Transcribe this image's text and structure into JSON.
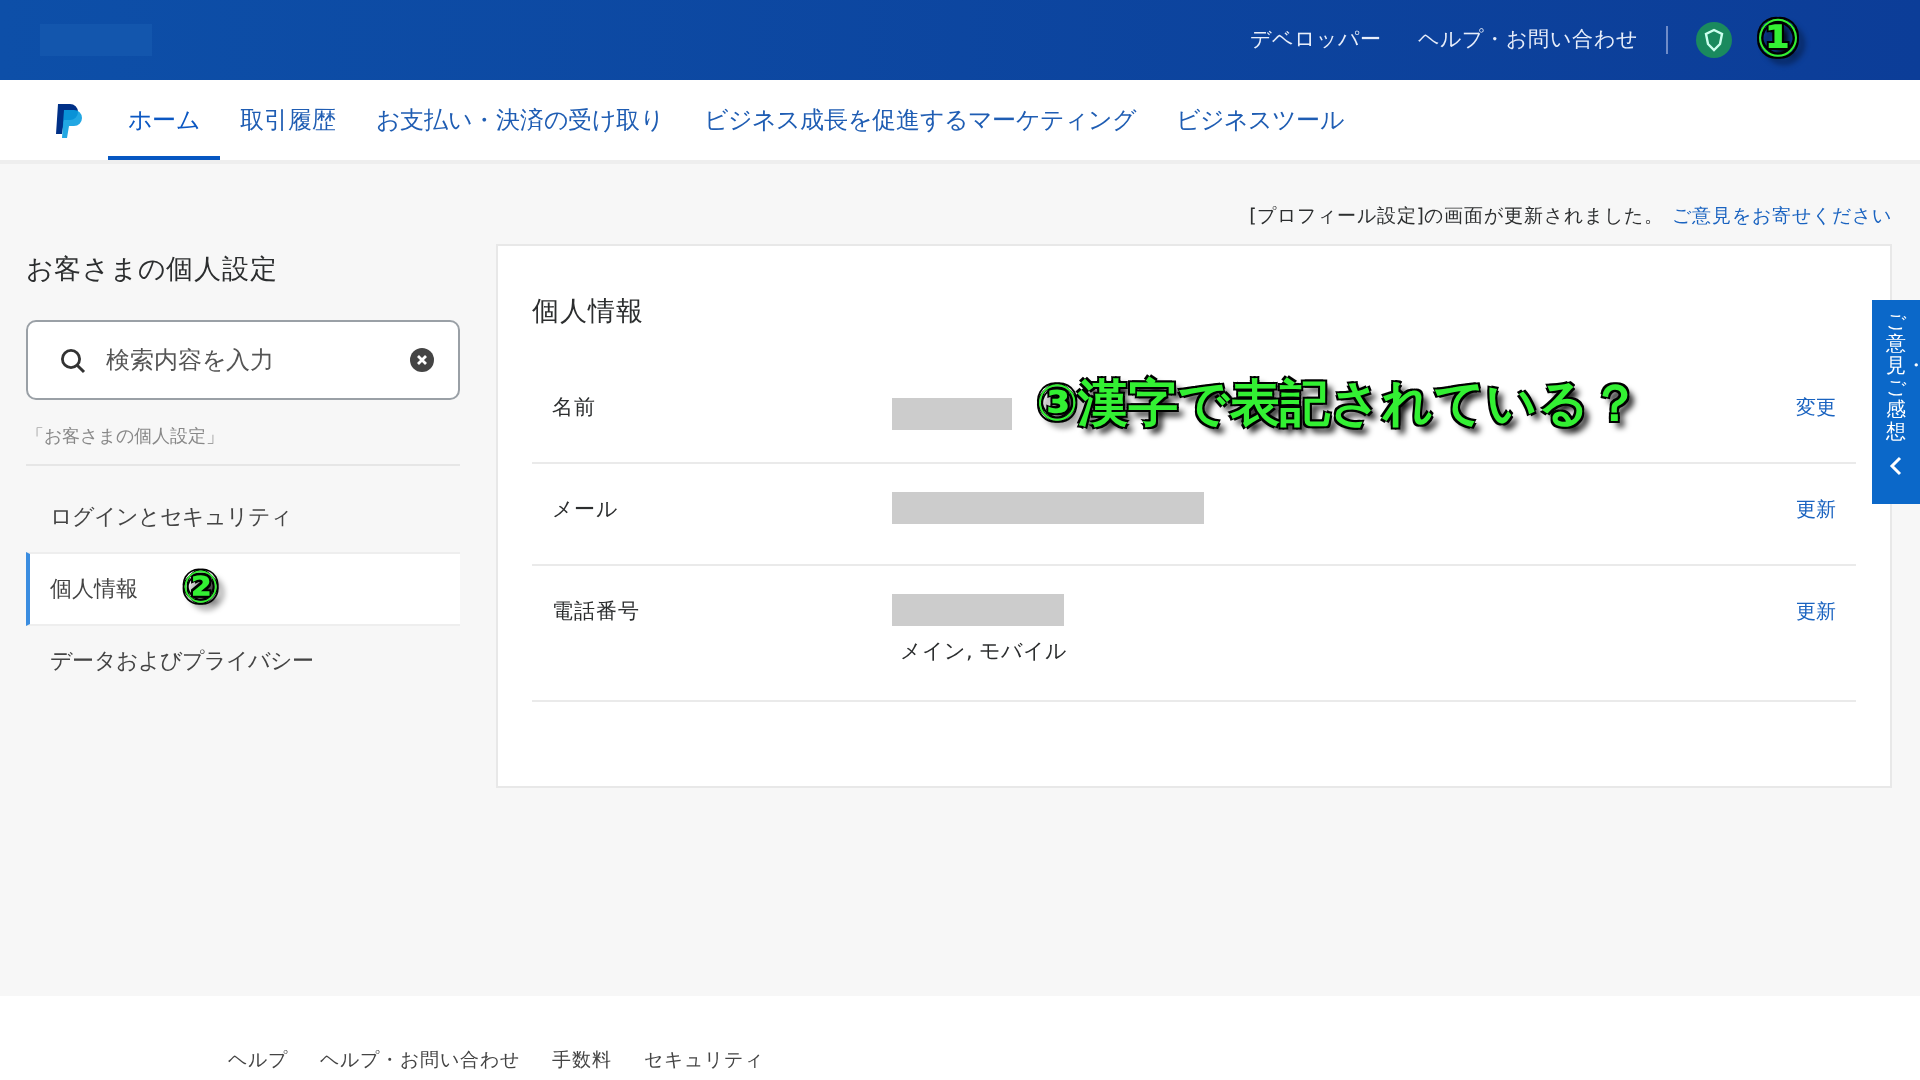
{
  "header": {
    "links": [
      "デベロッパー",
      "ヘルプ・お問い合わせ"
    ],
    "annotation": "①"
  },
  "nav": {
    "tabs": [
      {
        "label": "ホーム",
        "selected": true
      },
      {
        "label": "取引履歴",
        "selected": false
      },
      {
        "label": "お支払い・決済の受け取り",
        "selected": false
      },
      {
        "label": "ビジネス成長を促進するマーケティング",
        "selected": false
      },
      {
        "label": "ビジネスツール",
        "selected": false
      }
    ]
  },
  "notice": {
    "text": "[プロフィール設定]の画面が更新されました。",
    "link": "ご意見をお寄せください"
  },
  "sidebar": {
    "title": "お客さまの個人設定",
    "search": {
      "placeholder": "検索内容を入力"
    },
    "section_label": "「お客さまの個人設定」",
    "items": [
      {
        "label": "ログインとセキュリティ",
        "selected": false
      },
      {
        "label": "個人情報",
        "selected": true,
        "annotation": "②"
      },
      {
        "label": "データおよびプライバシー",
        "selected": false
      }
    ]
  },
  "card": {
    "title": "個人情報",
    "rows": [
      {
        "label": "名前",
        "action": "変更",
        "annotation": "③漢字で表記されている？"
      },
      {
        "label": "メール",
        "action": "更新"
      },
      {
        "label": "電話番号",
        "action": "更新",
        "note": "メイン, モバイル"
      }
    ]
  },
  "feedback_tab": {
    "label": "ご意見・ご感想"
  },
  "footer": {
    "links": [
      "ヘルプ",
      "ヘルプ・お問い合わせ",
      "手数料",
      "セキュリティ"
    ]
  }
}
